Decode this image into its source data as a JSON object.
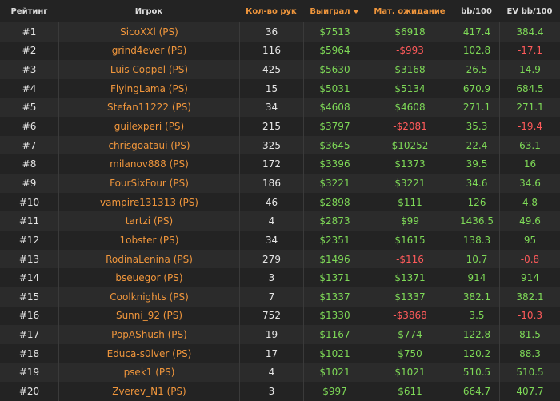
{
  "headers": {
    "rank": "Рейтинг",
    "player": "Игрок",
    "hands": "Кол-во рук",
    "won": "Выиграл",
    "ev": "Мат. ожидание",
    "bb100": "bb/100",
    "evbb100": "EV bb/100"
  },
  "colors": {
    "accent": "#f0963c",
    "positive": "#7ed957",
    "negative": "#ff5a5a"
  },
  "rows": [
    {
      "rank": "#1",
      "player": "SicoXXl (PS)",
      "hands": "36",
      "won": "$7513",
      "ev": "$6918",
      "bb100": "417.4",
      "evbb100": "384.4"
    },
    {
      "rank": "#2",
      "player": "grind4ever (PS)",
      "hands": "116",
      "won": "$5964",
      "ev": "-$993",
      "bb100": "102.8",
      "evbb100": "-17.1"
    },
    {
      "rank": "#3",
      "player": "Luis Coppel (PS)",
      "hands": "425",
      "won": "$5630",
      "ev": "$3168",
      "bb100": "26.5",
      "evbb100": "14.9"
    },
    {
      "rank": "#4",
      "player": "FlyingLama (PS)",
      "hands": "15",
      "won": "$5031",
      "ev": "$5134",
      "bb100": "670.9",
      "evbb100": "684.5"
    },
    {
      "rank": "#5",
      "player": "Stefan11222 (PS)",
      "hands": "34",
      "won": "$4608",
      "ev": "$4608",
      "bb100": "271.1",
      "evbb100": "271.1"
    },
    {
      "rank": "#6",
      "player": "guilexperi (PS)",
      "hands": "215",
      "won": "$3797",
      "ev": "-$2081",
      "bb100": "35.3",
      "evbb100": "-19.4"
    },
    {
      "rank": "#7",
      "player": "chrisgoataui (PS)",
      "hands": "325",
      "won": "$3645",
      "ev": "$10252",
      "bb100": "22.4",
      "evbb100": "63.1"
    },
    {
      "rank": "#8",
      "player": "milanov888 (PS)",
      "hands": "172",
      "won": "$3396",
      "ev": "$1373",
      "bb100": "39.5",
      "evbb100": "16"
    },
    {
      "rank": "#9",
      "player": "FourSixFour (PS)",
      "hands": "186",
      "won": "$3221",
      "ev": "$3221",
      "bb100": "34.6",
      "evbb100": "34.6"
    },
    {
      "rank": "#10",
      "player": "vampire131313 (PS)",
      "hands": "46",
      "won": "$2898",
      "ev": "$111",
      "bb100": "126",
      "evbb100": "4.8"
    },
    {
      "rank": "#11",
      "player": "tartzi (PS)",
      "hands": "4",
      "won": "$2873",
      "ev": "$99",
      "bb100": "1436.5",
      "evbb100": "49.6"
    },
    {
      "rank": "#12",
      "player": "1obster (PS)",
      "hands": "34",
      "won": "$2351",
      "ev": "$1615",
      "bb100": "138.3",
      "evbb100": "95"
    },
    {
      "rank": "#13",
      "player": "RodinaLenina (PS)",
      "hands": "279",
      "won": "$1496",
      "ev": "-$116",
      "bb100": "10.7",
      "evbb100": "-0.8"
    },
    {
      "rank": "#14",
      "player": "bseuegor (PS)",
      "hands": "3",
      "won": "$1371",
      "ev": "$1371",
      "bb100": "914",
      "evbb100": "914"
    },
    {
      "rank": "#15",
      "player": "Coolknights (PS)",
      "hands": "7",
      "won": "$1337",
      "ev": "$1337",
      "bb100": "382.1",
      "evbb100": "382.1"
    },
    {
      "rank": "#16",
      "player": "Sunni_92 (PS)",
      "hands": "752",
      "won": "$1330",
      "ev": "-$3868",
      "bb100": "3.5",
      "evbb100": "-10.3"
    },
    {
      "rank": "#17",
      "player": "PopAShush (PS)",
      "hands": "19",
      "won": "$1167",
      "ev": "$774",
      "bb100": "122.8",
      "evbb100": "81.5"
    },
    {
      "rank": "#18",
      "player": "Educa-s0lver (PS)",
      "hands": "17",
      "won": "$1021",
      "ev": "$750",
      "bb100": "120.2",
      "evbb100": "88.3"
    },
    {
      "rank": "#19",
      "player": "psek1 (PS)",
      "hands": "4",
      "won": "$1021",
      "ev": "$1021",
      "bb100": "510.5",
      "evbb100": "510.5"
    },
    {
      "rank": "#20",
      "player": "Zverev_N1 (PS)",
      "hands": "3",
      "won": "$997",
      "ev": "$611",
      "bb100": "664.7",
      "evbb100": "407.7"
    }
  ]
}
